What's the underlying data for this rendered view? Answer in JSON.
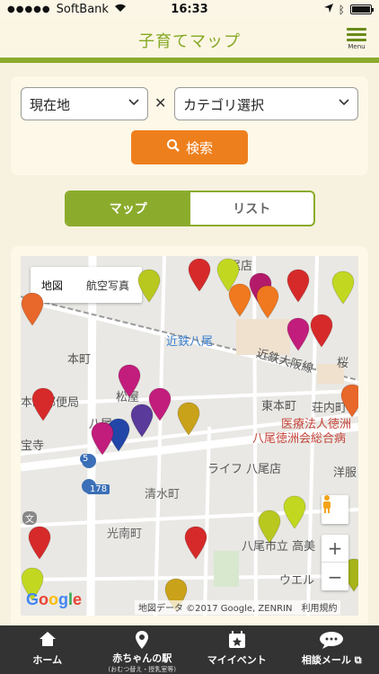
{
  "status_bar": {
    "carrier": "SoftBank",
    "time": "16:33"
  },
  "header": {
    "title": "子育てマップ",
    "menu_label": "Menu"
  },
  "search": {
    "location_value": "現在地",
    "category_value": "カテゴリ選択",
    "separator": "✕",
    "button_label": "検索"
  },
  "view_toggle": {
    "map_label": "マップ",
    "list_label": "リスト",
    "selected": "map"
  },
  "map": {
    "type_map": "地図",
    "type_satellite": "航空写真",
    "labels": {
      "yao_store": "尾店",
      "station": "近鉄八尾",
      "line": "近鉄大阪線",
      "honmachi": "本町",
      "higashi_honmachi": "東本町",
      "sounai": "荘内町",
      "post_office": "本町郵便局",
      "matsuya": "松屋",
      "hachio": "八尾",
      "hospital_1": "医療法人徳洲",
      "hospital_2": "八尾徳洲会総合病",
      "temple": "宝寺",
      "life": "ライフ 八尾店",
      "youfuku": "洋服",
      "shimizu": "清水町",
      "konan": "光南町",
      "school": "八尾市立 高美",
      "uel": "ウエル",
      "sakura": "桜",
      "route": "178",
      "route5": "5",
      "bun": "文"
    },
    "google": "Google",
    "attribution": "地図データ ©2017 Google, ZENRIN　利用規約",
    "pin_colors": [
      "#d62a2a",
      "#e8672a",
      "#f0781e",
      "#c2d820",
      "#b31b6a",
      "#c21d7c",
      "#5a3a9a",
      "#2246a8",
      "#c9a21a",
      "#b8c81e",
      "#a6b41a"
    ]
  },
  "tabbar": {
    "items": [
      {
        "label": "ホーム",
        "sub": ""
      },
      {
        "label": "赤ちゃんの駅",
        "sub": "(おむつ替え・授乳室等)"
      },
      {
        "label": "マイイベント",
        "sub": ""
      },
      {
        "label": "相談メール",
        "sub": ""
      }
    ]
  }
}
